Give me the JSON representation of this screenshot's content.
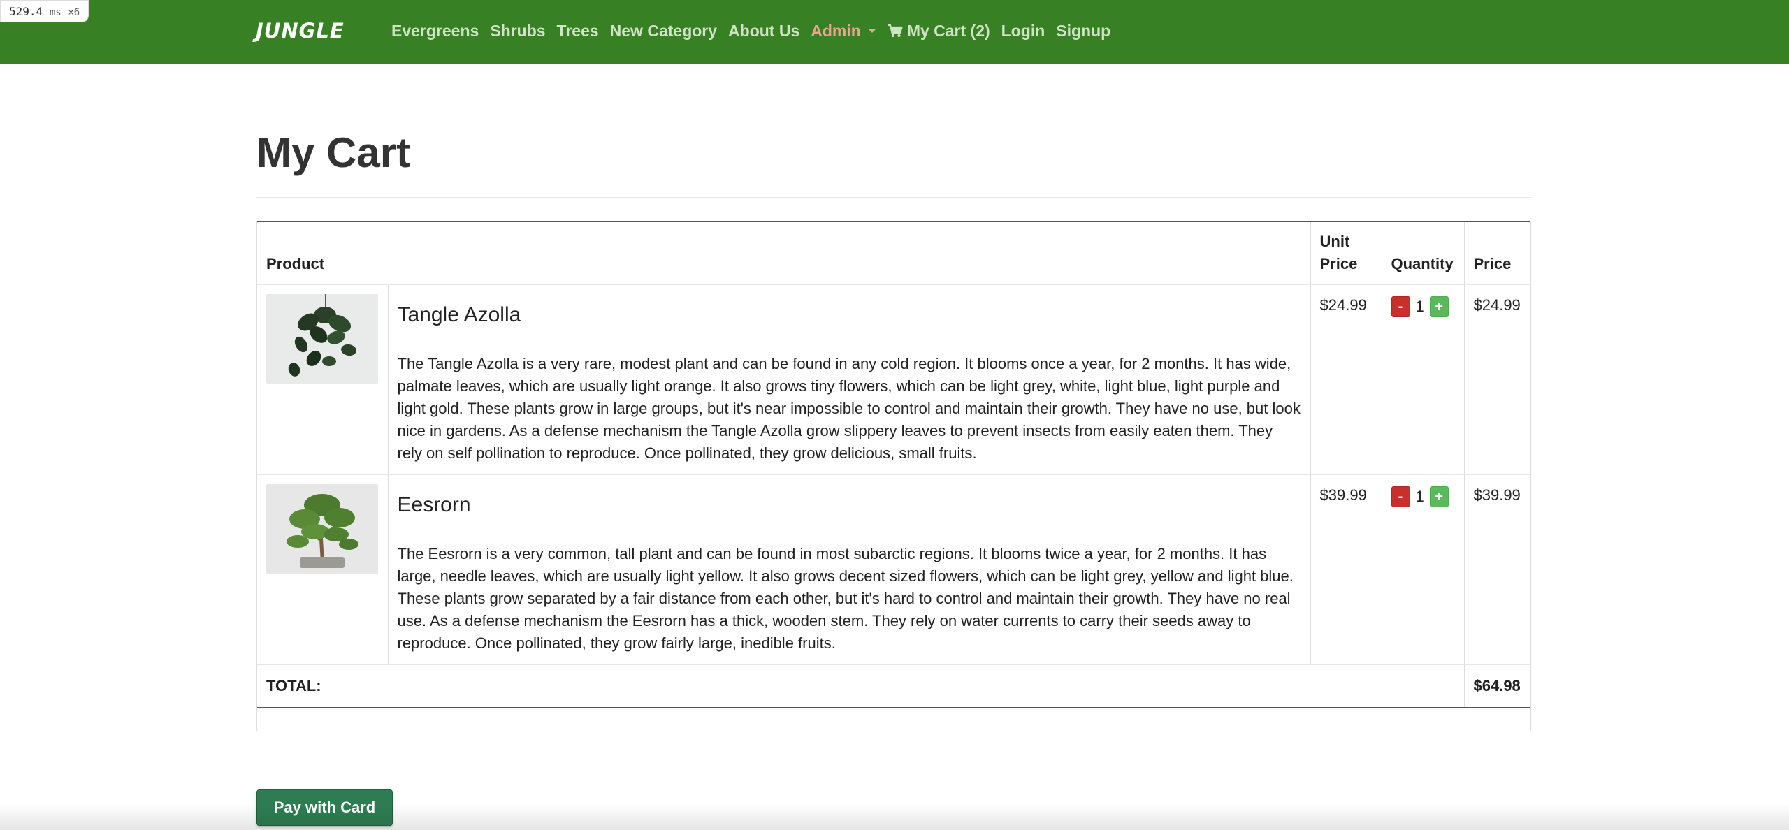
{
  "perf": {
    "value": "529.4",
    "unit": "ms",
    "mult": "×6"
  },
  "nav": {
    "brand": "JUNGLE",
    "links": [
      "Evergreens",
      "Shrubs",
      "Trees",
      "New Category",
      "About Us"
    ],
    "admin": "Admin",
    "cart": "My Cart (2)",
    "login": "Login",
    "signup": "Signup"
  },
  "page": {
    "title": "My Cart"
  },
  "table": {
    "headers": {
      "product": "Product",
      "unit_price": "Unit Price",
      "quantity": "Quantity",
      "price": "Price"
    },
    "items": [
      {
        "name": "Tangle Azolla",
        "description": "The Tangle Azolla is a very rare, modest plant and can be found in any cold region. It blooms once a year, for 2 months. It has wide, palmate leaves, which are usually light orange. It also grows tiny flowers, which can be light grey, white, light blue, light purple and light gold. These plants grow in large groups, but it's near impossible to control and maintain their growth. They have no use, but look nice in gardens. As a defense mechanism the Tangle Azolla grow slippery leaves to prevent insects from easily eaten them. They rely on self pollination to reproduce. Once pollinated, they grow delicious, small fruits.",
        "unit_price": "$24.99",
        "quantity": "1",
        "price": "$24.99",
        "minus": "-",
        "plus": "+"
      },
      {
        "name": "Eesrorn",
        "description": "The Eesrorn is a very common, tall plant and can be found in most subarctic regions. It blooms twice a year, for 2 months. It has large, needle leaves, which are usually light yellow. It also grows decent sized flowers, which can be light grey, yellow and light blue. These plants grow separated by a fair distance from each other, but it's hard to control and maintain their growth. They have no real use. As a defense mechanism the Eesrorn has a thick, wooden stem. They rely on water currents to carry their seeds away to reproduce. Once pollinated, they grow fairly large, inedible fruits.",
        "unit_price": "$39.99",
        "quantity": "1",
        "price": "$39.99",
        "minus": "-",
        "plus": "+"
      }
    ],
    "total_label": "TOTAL:",
    "total_value": "$64.98"
  },
  "pay_button": "Pay with Card",
  "colors": {
    "navbar": "#388024",
    "pay": "#2e7d52",
    "minus": "#c9302c",
    "plus": "#5cb85c"
  },
  "icons": {
    "cart": "shopping-cart-icon",
    "admin_caret": "caret-down-icon"
  }
}
